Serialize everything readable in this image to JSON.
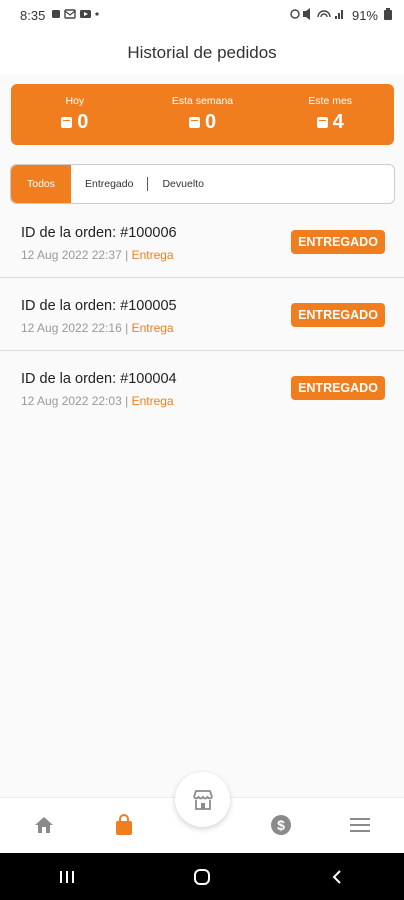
{
  "status_bar": {
    "time": "8:35",
    "battery": "91%"
  },
  "header": {
    "title": "Historial de pedidos"
  },
  "summary": [
    {
      "label": "Hoy",
      "value": "0"
    },
    {
      "label": "Esta semana",
      "value": "0"
    },
    {
      "label": "Este mes",
      "value": "4"
    }
  ],
  "tabs": [
    {
      "label": "Todos",
      "active": true
    },
    {
      "label": "Entregado"
    },
    {
      "label": "Devuelto"
    }
  ],
  "orders": [
    {
      "id": "ID de la orden: #100006",
      "datetime": "12 Aug 2022  22:37",
      "separator": "|",
      "type": "Entrega",
      "status": "ENTREGADO"
    },
    {
      "id": "ID de la orden: #100005",
      "datetime": "12 Aug 2022  22:16",
      "separator": "|",
      "type": "Entrega",
      "status": "ENTREGADO"
    },
    {
      "id": "ID de la orden: #100004",
      "datetime": "12 Aug 2022  22:03",
      "separator": "|",
      "type": "Entrega",
      "status": "ENTREGADO"
    }
  ],
  "bottom_nav": [
    {
      "icon": "home-icon",
      "active": false
    },
    {
      "icon": "shopping-bag-icon",
      "active": true
    },
    {
      "icon": "store-icon",
      "active": false
    },
    {
      "icon": "dollar-icon",
      "active": false
    },
    {
      "icon": "menu-icon",
      "active": false
    }
  ],
  "colors": {
    "accent": "#f07e1f",
    "muted": "#9a9a9a",
    "nav_inactive": "#8a8a8a"
  }
}
